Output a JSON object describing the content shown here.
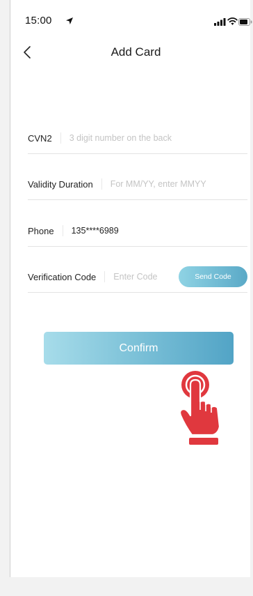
{
  "status_bar": {
    "time": "15:00",
    "icons": [
      "location-arrow-icon",
      "signal-icon",
      "wifi-icon",
      "battery-icon"
    ]
  },
  "nav": {
    "back_icon": "chevron-left-icon",
    "title": "Add Card"
  },
  "form": {
    "cvn2": {
      "label": "CVN2",
      "placeholder": "3 digit number on the back",
      "value": ""
    },
    "validity": {
      "label": "Validity Duration",
      "placeholder": "For MM/YY, enter MMYY",
      "value": ""
    },
    "phone": {
      "label": "Phone",
      "value": "135****6989"
    },
    "verification": {
      "label": "Verification Code",
      "placeholder": "Enter Code",
      "value": "",
      "send_label": "Send Code"
    }
  },
  "confirm_label": "Confirm",
  "overlay": {
    "icon": "tap-hand-icon"
  },
  "colors": {
    "accent_start": "#8fd3e4",
    "accent_end": "#52a4c6",
    "hand": "#e0383e",
    "text": "#222222",
    "placeholder": "#c4c4c4"
  }
}
